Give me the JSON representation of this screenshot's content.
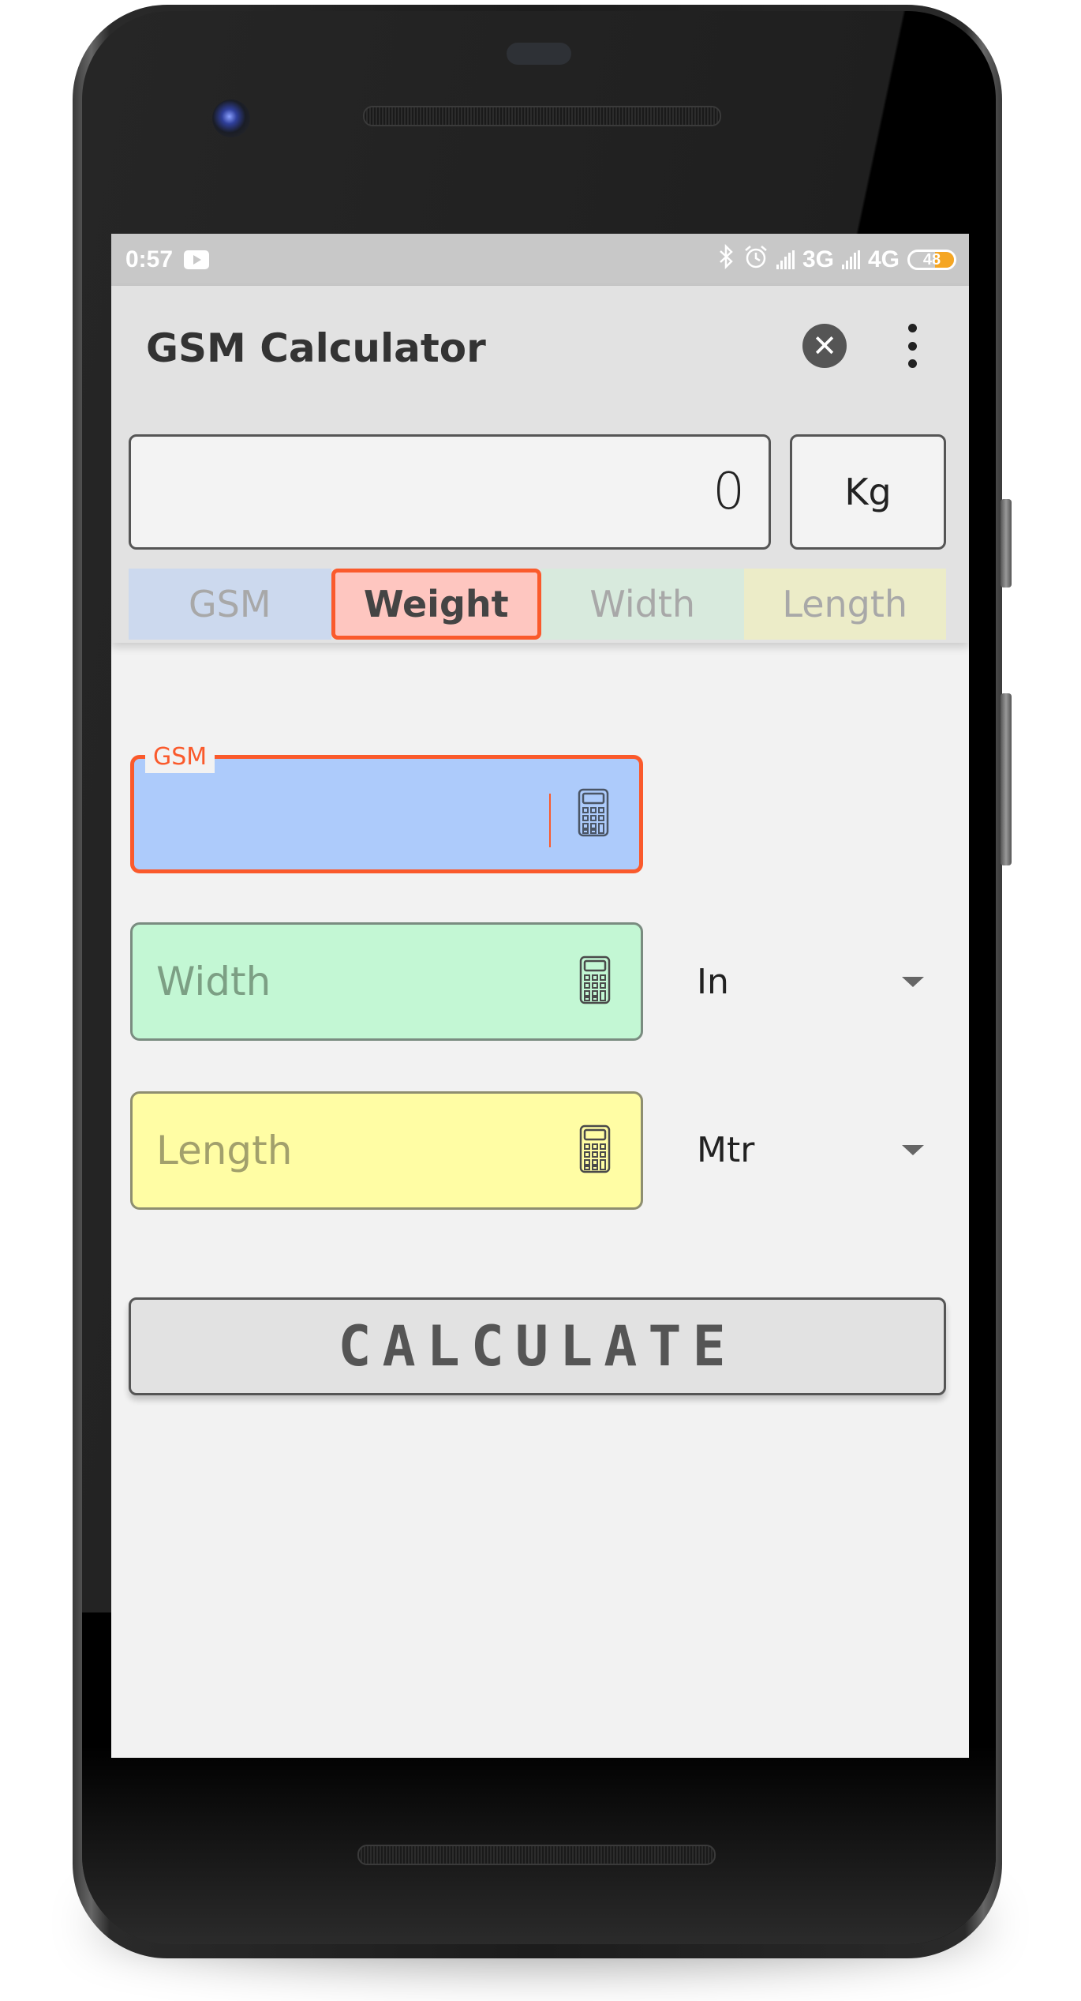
{
  "status_bar": {
    "time": "0:57",
    "network_1": "3G",
    "network_2": "4G",
    "battery_level": "48",
    "icons": [
      "youtube-icon",
      "bluetooth-icon",
      "alarm-icon",
      "signal-icon",
      "signal-icon",
      "battery-icon"
    ]
  },
  "app_bar": {
    "title": "GSM Calculator",
    "close_icon": "✕",
    "menu_icon": "more-vert-icon"
  },
  "result": {
    "value": "0",
    "unit": "Kg"
  },
  "mode_tabs": [
    {
      "label": "GSM",
      "selected": false,
      "color": "#ccd9ee"
    },
    {
      "label": "Weight",
      "selected": true,
      "color": "#fec6c0"
    },
    {
      "label": "Width",
      "selected": false,
      "color": "#d8eadd"
    },
    {
      "label": "Length",
      "selected": false,
      "color": "#ececc8"
    }
  ],
  "form": {
    "gsm": {
      "label": "GSM",
      "value": "",
      "placeholder": "GSM",
      "focused": true
    },
    "width": {
      "value": "",
      "placeholder": "Width",
      "unit": "In"
    },
    "length": {
      "value": "",
      "placeholder": "Length",
      "unit": "Mtr"
    }
  },
  "calculate_button": {
    "label": "CALCULATE"
  },
  "colors": {
    "accent": "#fa5a2c",
    "gsm_field": "#adcbfb",
    "width_field": "#c3f7d4",
    "length_field": "#fffda4"
  }
}
